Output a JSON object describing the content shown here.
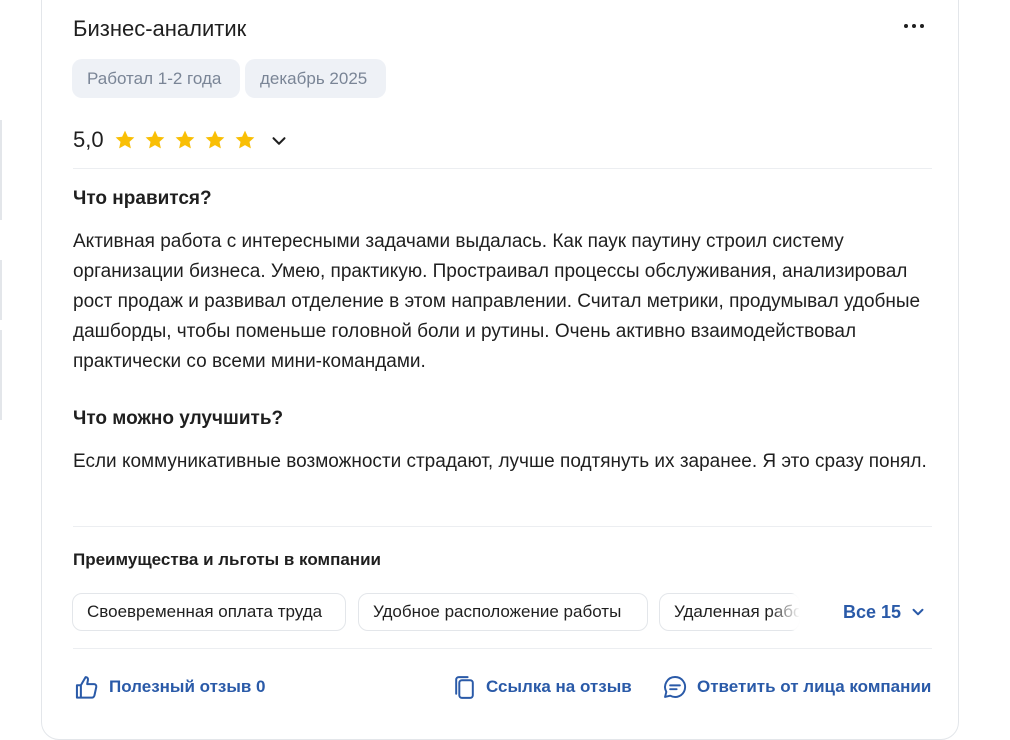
{
  "review": {
    "title": "Бизнес-аналитик",
    "tags": [
      "Работал 1-2 года",
      "декабрь 2025"
    ],
    "rating": "5,0",
    "stars": 5,
    "likes_heading": "Что нравится?",
    "likes_text": "Активная работа с интересными задачами выдалась. Как паук паутину строил систему организации бизнеса. Умею, практикую. Простраивал процессы обслуживания, анализировал рост продаж и развивал отделение в этом направлении. Считал метрики, продумывал удобные дашборды, чтобы поменьше головной боли и рутины. Очень активно взаимодействовал практически со всеми мини-командами.",
    "improve_heading": "Что можно улучшить?",
    "improve_text": "Если коммуникативные возможности страдают, лучше подтянуть их заранее. Я это сразу понял."
  },
  "benefits": {
    "heading": "Преимущества и льготы в компании",
    "items": [
      "Своевременная оплата труда",
      "Удобное расположение работы",
      "Удаленная работа"
    ],
    "all_label": "Все 15"
  },
  "actions": {
    "helpful": "Полезный отзыв 0",
    "link": "Ссылка на отзыв",
    "reply": "Ответить от лица компании"
  },
  "colors": {
    "star": "#f9bf05",
    "link": "#2a5aa8",
    "tag_bg": "#eef1f6"
  },
  "icons": [
    "more-horizontal-icon",
    "star-icon",
    "chevron-down-icon",
    "thumbs-up-icon",
    "copy-link-icon",
    "chat-reply-icon"
  ]
}
